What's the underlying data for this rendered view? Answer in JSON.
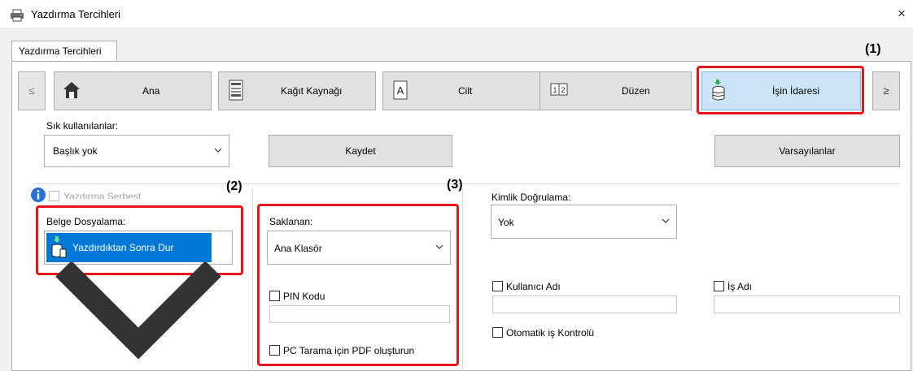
{
  "window": {
    "title": "Yazdırma Tercihleri",
    "close": "×"
  },
  "tabs": {
    "main": "Yazdırma Tercihleri"
  },
  "ribbon": {
    "prev": "≤",
    "next": "≥",
    "items": [
      {
        "label": "Ana",
        "icon": "home-icon"
      },
      {
        "label": "Kağıt Kaynağı",
        "icon": "paper-tray-icon"
      },
      {
        "label": "Cilt",
        "icon": "binding-icon"
      },
      {
        "label": "Düzen",
        "icon": "layout-icon"
      },
      {
        "label": "İşin İdaresi",
        "icon": "job-storage-icon",
        "selected": true
      }
    ]
  },
  "favorites": {
    "label": "Sık kullanılanlar:",
    "value": "Başlık yok",
    "save": "Kaydet",
    "defaults": "Varsayılanlar"
  },
  "left": {
    "retention_checkbox": "Yazdırma Serbest",
    "doc_filing_label": "Belge Dosyalama:",
    "doc_filing_value": "Yazdırdıktan Sonra Dur"
  },
  "middle": {
    "stored_label": "Saklanan:",
    "stored_value": "Ana Klasör",
    "pin_label": "PIN Kodu",
    "pin_value": "",
    "pdf_label": "PC Tarama için PDF oluşturun"
  },
  "right": {
    "auth_label": "Kimlik Doğrulama:",
    "auth_value": "Yok",
    "username_label": "Kullanıcı Adı",
    "username_value": "",
    "jobname_label": "İş Adı",
    "jobname_value": "",
    "auto_job_control": "Otomatik iş Kontrolü"
  },
  "callouts": [
    "(1)",
    "(2)",
    "(3)"
  ],
  "colors": {
    "highlight": "#e8141d",
    "selected_tab": "#cce4f7",
    "dropdown_selected": "#0078d7"
  }
}
